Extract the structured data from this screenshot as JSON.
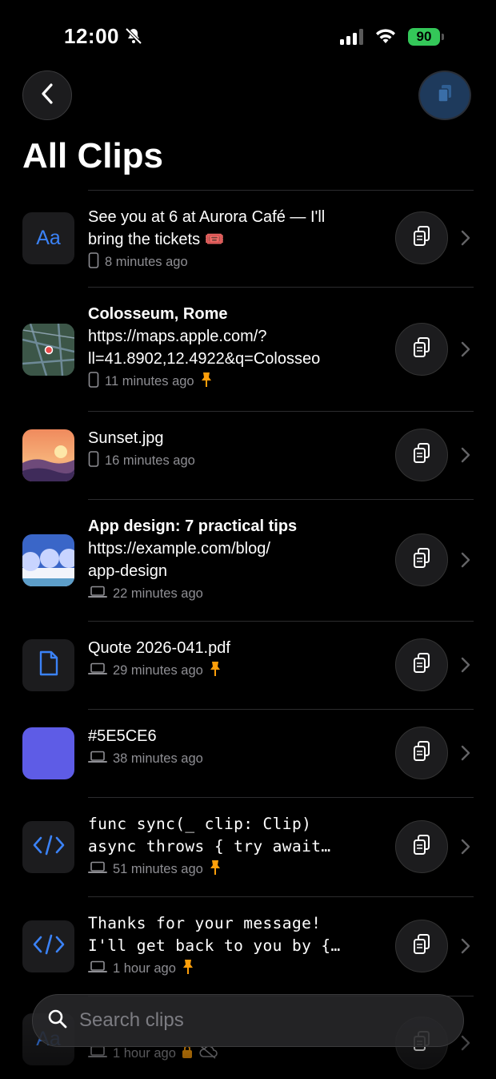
{
  "status_bar": {
    "time": "12:00",
    "battery": "90"
  },
  "header": {
    "title": "All Clips"
  },
  "search": {
    "placeholder": "Search clips"
  },
  "clips": [
    {
      "lines": [
        "See you at 6 at Aurora Café — I'll",
        "bring the tickets 🎟️"
      ],
      "time": "8 minutes ago",
      "device": "phone"
    },
    {
      "title": "Colosseum, Rome",
      "lines": [
        "https://maps.apple.com/?",
        "ll=41.8902,12.4922&q=Colosseo"
      ],
      "time": "11 minutes ago",
      "device": "phone",
      "pinned": true
    },
    {
      "lines": [
        "Sunset.jpg"
      ],
      "time": "16 minutes ago",
      "device": "phone"
    },
    {
      "title": "App design: 7 practical tips",
      "lines": [
        "https://example.com/blog/",
        "app-design"
      ],
      "time": "22 minutes ago",
      "device": "laptop"
    },
    {
      "lines": [
        "Quote 2026-041.pdf"
      ],
      "time": "29 minutes ago",
      "device": "laptop",
      "pinned": true
    },
    {
      "lines": [
        "#5E5CE6"
      ],
      "time": "38 minutes ago",
      "device": "laptop",
      "swatch": "#5E5CE6"
    },
    {
      "lines": [
        "func sync(_ clip: Clip)",
        "async throws { try await…"
      ],
      "time": "51 minutes ago",
      "device": "laptop",
      "pinned": true
    },
    {
      "lines": [
        "Thanks for your message!",
        "I'll get back to you by {…"
      ],
      "time": "1 hour ago",
      "device": "laptop",
      "pinned": true
    },
    {
      "time": "1 hour ago",
      "device": "laptop",
      "locked": true,
      "cloud_off": true
    }
  ],
  "text_thumb_label": "Aa",
  "colors": {
    "accent": "#3B82F6",
    "pin": "#FF9F0A",
    "swatch": "#5E5CE6",
    "battery": "#34C759"
  }
}
